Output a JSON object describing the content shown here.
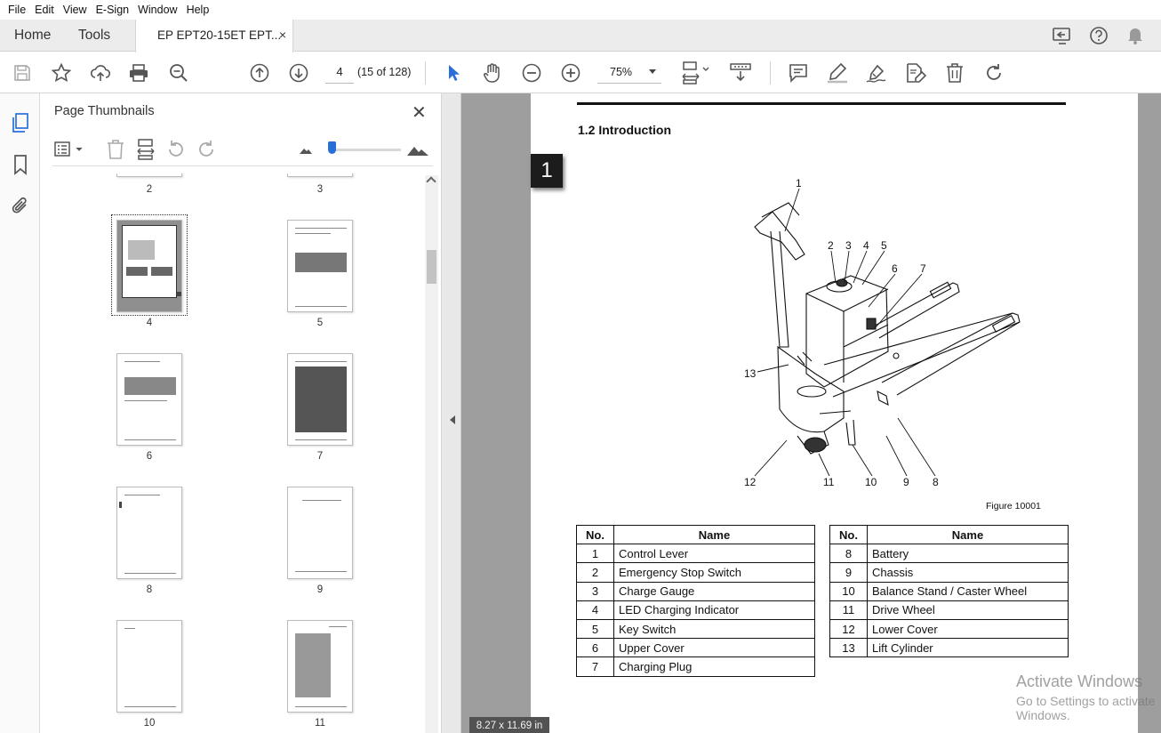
{
  "menu": [
    "File",
    "Edit",
    "View",
    "E-Sign",
    "Window",
    "Help"
  ],
  "tabs": {
    "home": "Home",
    "tools": "Tools",
    "document": "EP EPT20-15ET EPT...",
    "close": "×"
  },
  "toolbar": {
    "page_input": "4",
    "page_count": "(15 of 128)",
    "zoom": "75%"
  },
  "panel": {
    "title": "Page Thumbnails",
    "close": "✕",
    "thumbnails": [
      {
        "label": "2"
      },
      {
        "label": "3"
      },
      {
        "label": "4",
        "selected": true
      },
      {
        "label": "5"
      },
      {
        "label": "6"
      },
      {
        "label": "7"
      },
      {
        "label": "8"
      },
      {
        "label": "9"
      },
      {
        "label": "10"
      },
      {
        "label": "11"
      }
    ]
  },
  "document": {
    "heading": "1.2 Introduction",
    "tab_marker": "1",
    "figure_caption": "Figure 10001",
    "callouts": [
      "1",
      "2",
      "3",
      "4",
      "5",
      "6",
      "7",
      "8",
      "9",
      "10",
      "11",
      "12",
      "13"
    ],
    "table_headers": {
      "no": "No.",
      "name": "Name"
    },
    "left_table": [
      {
        "no": "1",
        "name": "Control Lever"
      },
      {
        "no": "2",
        "name": "Emergency Stop Switch"
      },
      {
        "no": "3",
        "name": "Charge Gauge"
      },
      {
        "no": "4",
        "name": "LED Charging Indicator"
      },
      {
        "no": "5",
        "name": "Key Switch"
      },
      {
        "no": "6",
        "name": "Upper Cover"
      },
      {
        "no": "7",
        "name": "Charging Plug"
      }
    ],
    "right_table": [
      {
        "no": "8",
        "name": "Battery"
      },
      {
        "no": "9",
        "name": "Chassis"
      },
      {
        "no": "10",
        "name": "Balance Stand / Caster Wheel"
      },
      {
        "no": "11",
        "name": "Drive Wheel"
      },
      {
        "no": "12",
        "name": "Lower Cover"
      },
      {
        "no": "13",
        "name": "Lift Cylinder"
      }
    ],
    "page_size": "8.27 x 11.69 in"
  },
  "watermark": {
    "line1": "Activate Windows",
    "line2": "Go to Settings to activate Windows."
  },
  "colors": {
    "accent": "#2a6fd8",
    "doc_background": "#9e9e9e",
    "tab_background": "#ececec"
  }
}
